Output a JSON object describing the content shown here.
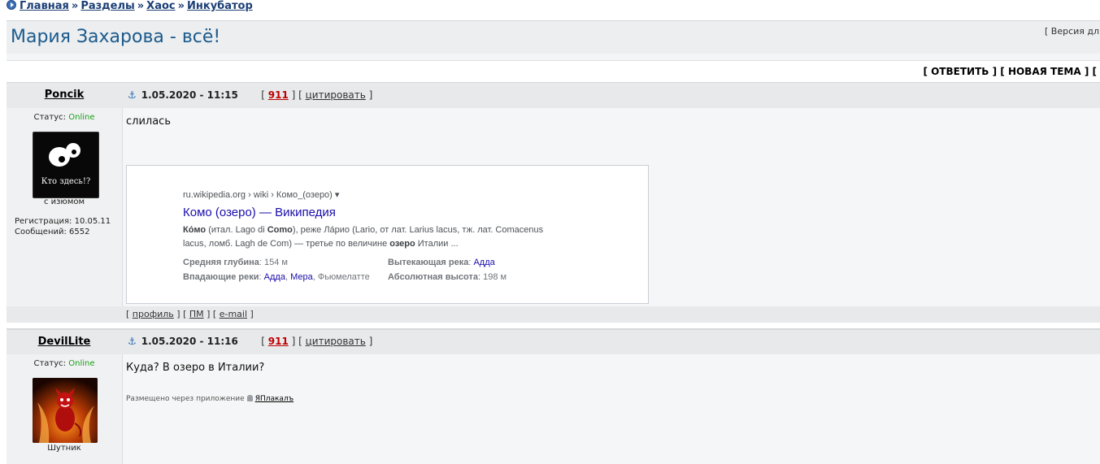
{
  "breadcrumb": {
    "items": [
      "Главная",
      "Разделы",
      "Хаос",
      "Инкубатор"
    ],
    "separator": "»"
  },
  "topic": {
    "title": "Мария Захарова - всё!",
    "version_link": "[ Версия дл"
  },
  "actions": {
    "open": "[",
    "reply": "ОТВЕТИТЬ",
    "middle": "] [",
    "new_topic": "НОВАЯ ТЕМА",
    "close": "] ["
  },
  "posts": [
    {
      "username": "Poncik",
      "status_label": "Статус:",
      "status_value": "Online",
      "avatar_text": "Кто здесь!?",
      "avatar_caption": "с изюмом",
      "registration": "Регистрация: 10.05.11",
      "messages": "Сообщений: 6552",
      "datetime": "1.05.2020 - 11:15",
      "post_number": "911",
      "quote_label": "цитировать",
      "text": "слилась",
      "footer": {
        "profile": "профиль",
        "pm": "ПМ",
        "email": "e-mail"
      }
    },
    {
      "username": "DevilLite",
      "status_label": "Статус:",
      "status_value": "Online",
      "avatar_caption": "Шутник",
      "datetime": "1.05.2020 - 11:16",
      "post_number": "911",
      "quote_label": "цитировать",
      "text": "Куда? В озеро в Италии?",
      "app_note": "Размещено через приложение",
      "app_name": "ЯПлакалъ"
    }
  ],
  "wiki_card": {
    "url": "ru.wikipedia.org › wiki › Комо_(озеро) ▾",
    "title": "Комо (озеро) — Википедия",
    "snippet_1_a": "Ко́мо",
    "snippet_1_b": " (итал. Lago di ",
    "snippet_1_c": "Como",
    "snippet_1_d": "), реже Ла́рио (Lario, от лат. Larius lacus, тж. лат. Comacenus",
    "snippet_2_a": "lacus, ломб. Lagh de Com) — третье по величине ",
    "snippet_2_b": "озеро",
    "snippet_2_c": " Италии ...",
    "facts": {
      "depth_key": "Средняя глубина",
      "depth_val": ": 154 м",
      "outflow_key": "Вытекающая река",
      "outflow_sep": ": ",
      "outflow_val": "Адда",
      "inflow_key": "Впадающие реки",
      "inflow_sep": ": ",
      "inflow_1": "Адда",
      "inflow_comma": ", ",
      "inflow_2": "Мера",
      "inflow_3": ", Фьюмелатте",
      "height_key": "Абсолютная высота",
      "height_val": ": 198 м"
    }
  },
  "colors": {
    "title": "#1b5a8d",
    "link_blue": "#1a0dab",
    "online": "#1a9e1a",
    "post_number": "#c00000"
  }
}
